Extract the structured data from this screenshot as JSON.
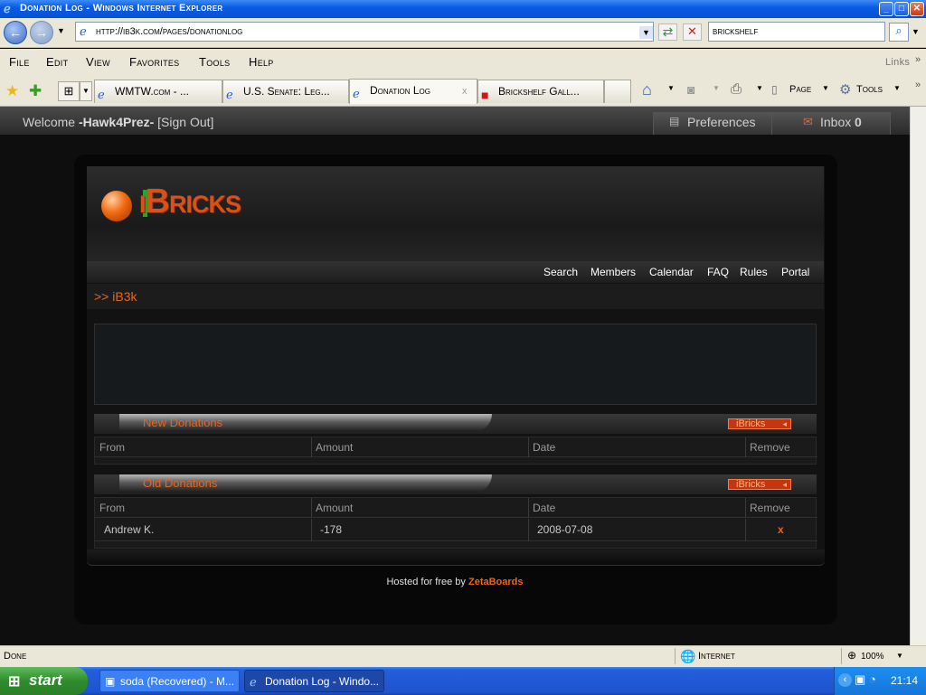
{
  "window": {
    "title": "Donation Log - Windows Internet Explorer"
  },
  "addressbar": {
    "url": "http://ib3k.com/pages/donationlog",
    "search": "brickshelf"
  },
  "menu": [
    "File",
    "Edit",
    "View",
    "Favorites",
    "Tools",
    "Help"
  ],
  "links_label": "Links",
  "tabs": [
    {
      "label": "WMTW.com - ..."
    },
    {
      "label": "U.S. Senate: Leg..."
    },
    {
      "label": "Donation Log"
    },
    {
      "label": "Brickshelf Gall..."
    }
  ],
  "toolbar": {
    "page_label": "Page",
    "tools_label": "Tools"
  },
  "forum": {
    "welcome_prefix": "Welcome",
    "username": "-Hawk4Prez-",
    "sign_out": "[Sign Out]",
    "preferences": "Preferences",
    "inbox_label": "Inbox",
    "inbox_count": "0",
    "logo_text": "iBricks",
    "nav": [
      "Search",
      "Members",
      "Calendar",
      "FAQ",
      "Rules",
      "Portal"
    ],
    "breadcrumb": ">> iB3k",
    "new_donations": {
      "title": "New Donations",
      "badge": "iBricks",
      "columns": [
        "From",
        "Amount",
        "Date",
        "Remove"
      ]
    },
    "old_donations": {
      "title": "Old Donations",
      "badge": "iBricks",
      "columns": [
        "From",
        "Amount",
        "Date",
        "Remove"
      ],
      "rows": [
        {
          "from": "Andrew K.",
          "amount": "-178",
          "date": "2008-07-08",
          "remove": "x"
        }
      ]
    },
    "footer_prefix": "Hosted for free by",
    "footer_link": "ZetaBoards"
  },
  "status": {
    "text": "Done",
    "zone": "Internet",
    "zoom": "100%"
  },
  "taskbar": {
    "start": "start",
    "items": [
      "soda (Recovered) - M...",
      "Donation Log - Windo..."
    ],
    "clock": "21:14"
  },
  "colors": {
    "accent": "#e8661f",
    "xp_blue": "#245edb"
  }
}
